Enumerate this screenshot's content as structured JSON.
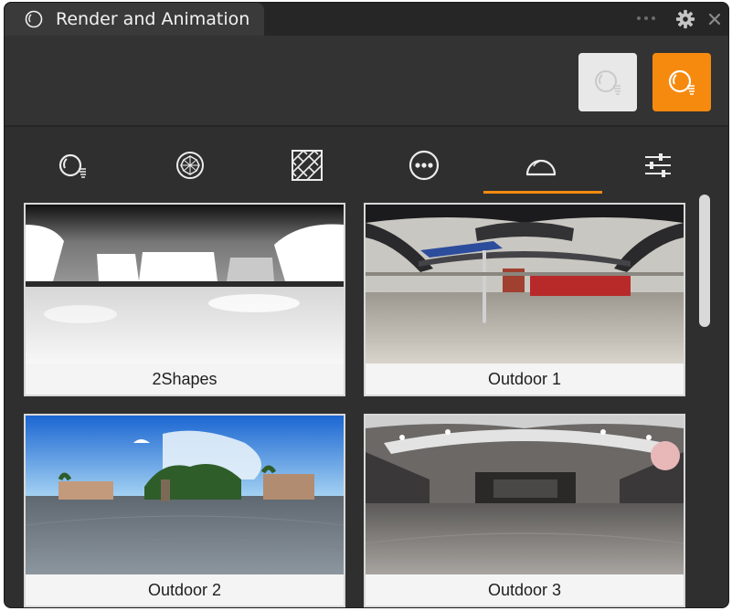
{
  "window": {
    "title": "Render and Animation",
    "icons": {
      "title": "render-orb-icon",
      "more": "more-dots-icon",
      "settings": "gear-icon",
      "close": "close-icon"
    }
  },
  "toolbar": {
    "buttons": [
      {
        "name": "preview-mode",
        "icon": "render-orb-icon",
        "state": "inactive",
        "color": "#e8e8e8"
      },
      {
        "name": "render-mode",
        "icon": "render-orb-icon",
        "state": "active",
        "color": "#f58a0f"
      }
    ]
  },
  "tabs": [
    {
      "id": "render",
      "icon": "render-orb-icon",
      "selected": false
    },
    {
      "id": "materials",
      "icon": "gem-icon",
      "selected": false
    },
    {
      "id": "textures",
      "icon": "texture-pattern-icon",
      "selected": false
    },
    {
      "id": "more",
      "icon": "ellipsis-circle-icon",
      "selected": false
    },
    {
      "id": "environment",
      "icon": "dome-icon",
      "selected": true
    },
    {
      "id": "settings",
      "icon": "sliders-icon",
      "selected": false
    }
  ],
  "environments": [
    {
      "label": "2Shapes"
    },
    {
      "label": "Outdoor 1"
    },
    {
      "label": "Outdoor 2"
    },
    {
      "label": "Outdoor 3"
    }
  ],
  "accent_color": "#f58a0f"
}
